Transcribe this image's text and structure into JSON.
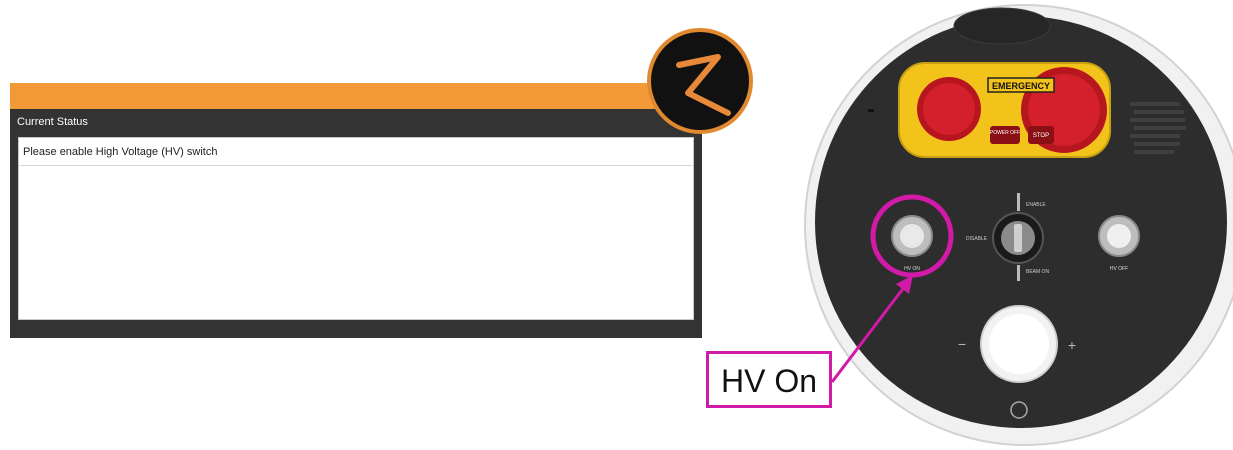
{
  "status_panel": {
    "header": "Current Status",
    "message": "Please enable High Voltage (HV) switch"
  },
  "logo": {
    "glyph": "Z"
  },
  "device": {
    "emergency_label": "EMERGENCY",
    "power_off_label": "POWER OFF",
    "stop_label": "STOP",
    "enable_label": "ENABLE",
    "disable_label": "DISABLE",
    "beam_on_label": "BEAM ON",
    "hv_on_label": "HV ON",
    "hv_off_label": "HV OFF",
    "minus_label": "−",
    "plus_label": "+"
  },
  "callout": {
    "text": "HV On",
    "color": "#d21aa8"
  },
  "colors": {
    "accent": "#f29a38",
    "panel": "#333333",
    "device": "#2b2b2b",
    "emergency_yellow": "#f2c31b",
    "stop_red": "#d3202a"
  }
}
